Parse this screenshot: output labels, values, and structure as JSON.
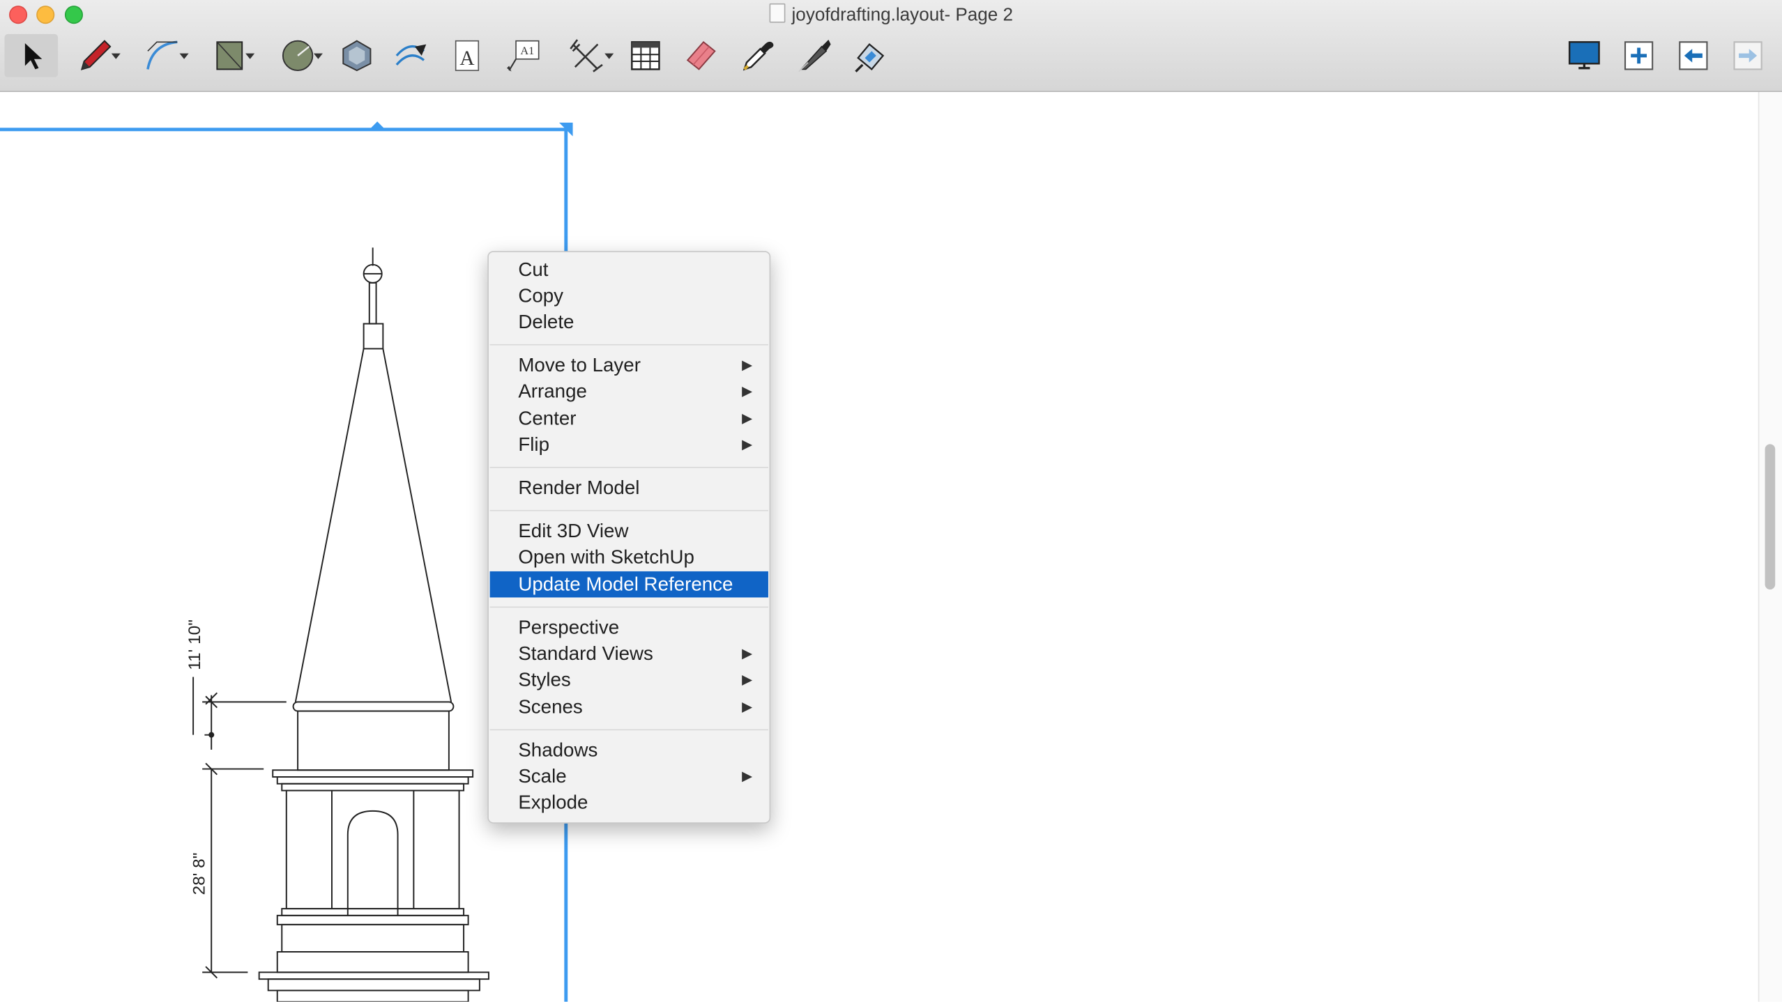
{
  "window": {
    "title": "joyofdrafting.layout- Page 2"
  },
  "toolbar": {
    "tools": [
      "select-tool",
      "pencil-tool",
      "arc-tool",
      "rectangle-tool",
      "circle-tool",
      "polygon-tool",
      "offset-tool",
      "text-tool",
      "label-tool",
      "dimension-tool",
      "table-tool",
      "eraser-tool",
      "style-tool",
      "split-tool",
      "join-tool"
    ],
    "right_tools": [
      "present-icon",
      "add-page-icon",
      "previous-page-icon",
      "next-page-icon"
    ]
  },
  "drawing": {
    "dim_upper": "11' 10\"",
    "dim_lower": "28' 8\""
  },
  "context_menu": {
    "selected": "Update Model Reference",
    "items": {
      "cut": "Cut",
      "copy": "Copy",
      "delete": "Delete",
      "move_to_layer": "Move to Layer",
      "arrange": "Arrange",
      "center": "Center",
      "flip": "Flip",
      "render_model": "Render Model",
      "edit_3d_view": "Edit 3D View",
      "open_with_sketchup": "Open with SketchUp",
      "update_model_reference": "Update Model Reference",
      "perspective": "Perspective",
      "standard_views": "Standard Views",
      "styles": "Styles",
      "scenes": "Scenes",
      "shadows": "Shadows",
      "scale": "Scale",
      "explode": "Explode"
    },
    "submenu_arrow": "▶"
  },
  "colors": {
    "selection_blue": "#3d9bf0",
    "menu_highlight": "#1064c6"
  }
}
